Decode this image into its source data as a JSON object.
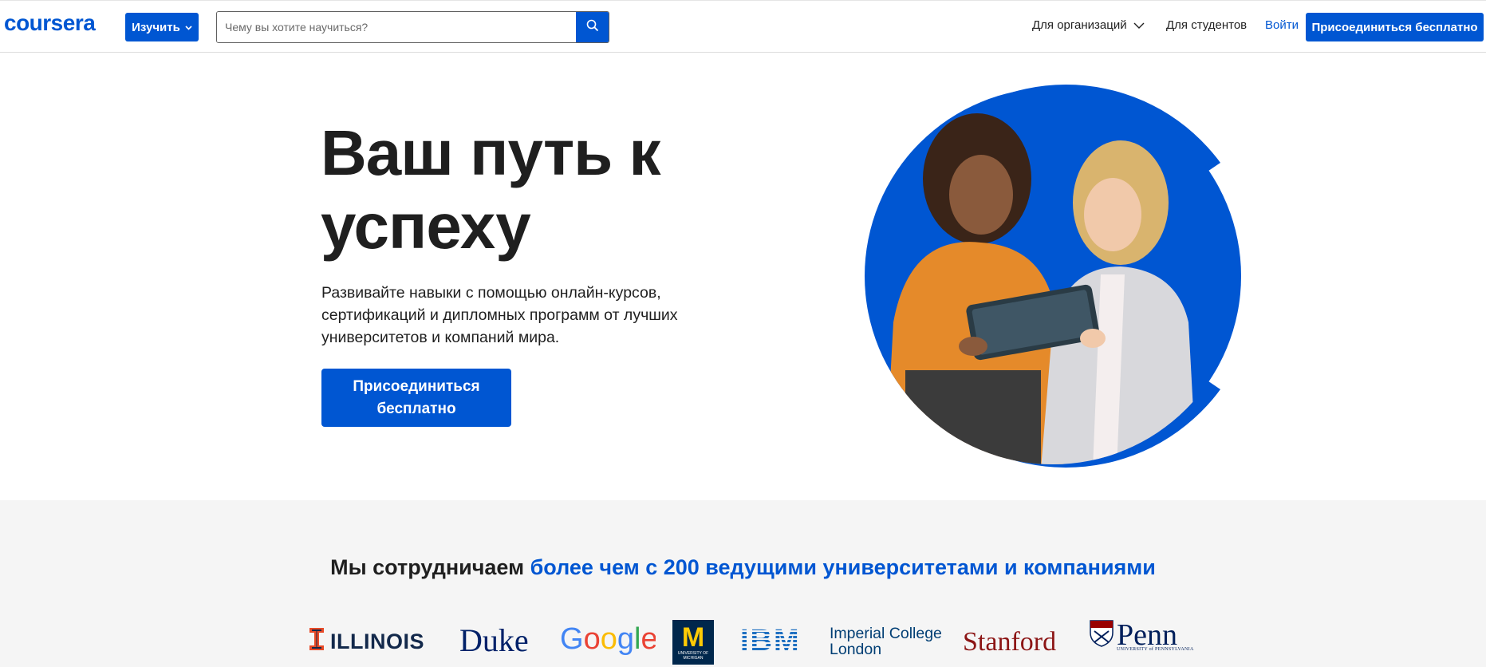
{
  "header": {
    "logo_text": "coursera",
    "explore_label": "Изучить",
    "search": {
      "placeholder": "Чему вы хотите научиться?",
      "value": ""
    },
    "nav": {
      "organizations": "Для организаций",
      "students": "Для студентов",
      "login": "Войти",
      "join": "Присоединиться бесплатно"
    }
  },
  "hero": {
    "title": "Ваш путь к успеху",
    "subtitle": "Развивайте навыки с помощью онлайн-курсов, сертификаций и дипломных программ от лучших университетов и компаний мира.",
    "cta": "Присоединиться бесплатно"
  },
  "partners": {
    "heading_prefix": "Мы сотрудничаем ",
    "heading_accent": "более чем с 200 ведущими университетами и компаниями",
    "logos": {
      "illinois": "ILLINOIS",
      "duke": "Duke",
      "google": "Google",
      "michigan": "M",
      "michigan_small": "UNIVERSITY OF MICHIGAN",
      "ibm": "IBM",
      "imperial_line1": "Imperial College",
      "imperial_line2": "London",
      "stanford": "Stanford",
      "penn": "Penn",
      "penn_small": "UNIVERSITY of PENNSYLVANIA"
    }
  },
  "colors": {
    "brand_blue": "#0056d2",
    "partners_bg": "#f5f5f5",
    "text_dark": "#1f1f1f"
  }
}
